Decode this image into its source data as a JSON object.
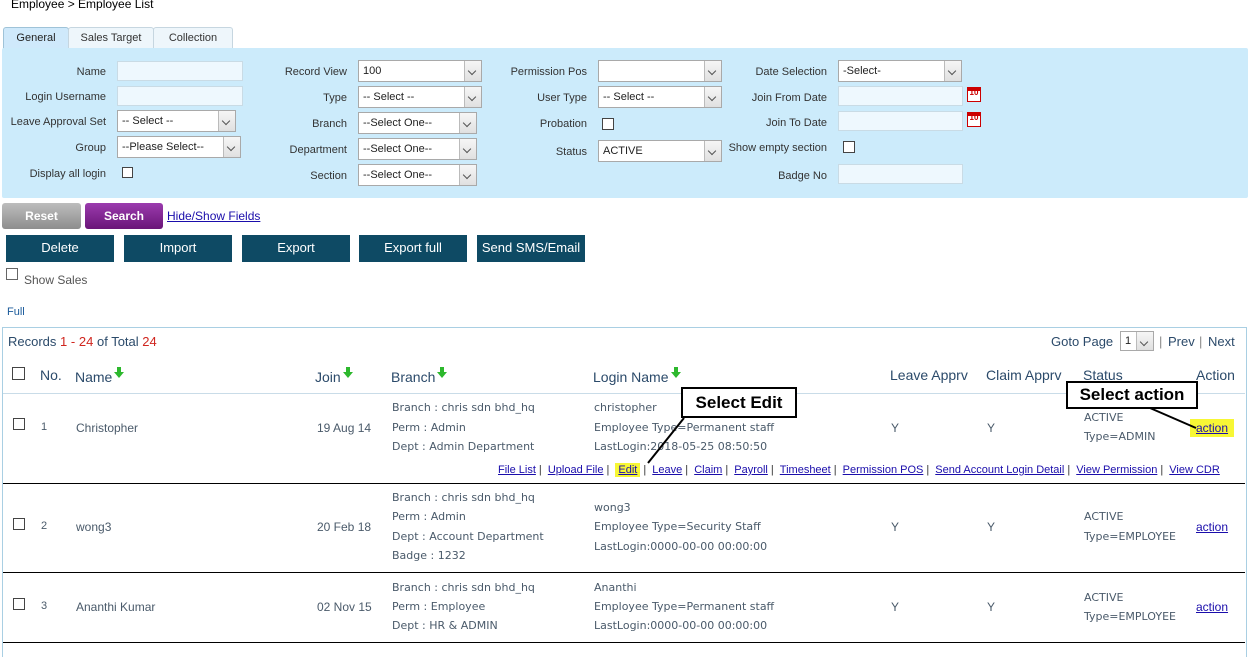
{
  "breadcrumb": "Employee > Employee List",
  "tabs": [
    "General",
    "Sales Target",
    "Collection"
  ],
  "filters": {
    "name_label": "Name",
    "login_username_label": "Login Username",
    "leave_approval_set_label": "Leave Approval Set",
    "leave_approval_set_value": "-- Select --",
    "group_label": "Group",
    "group_value": "--Please Select--",
    "display_all_login_label": "Display all login",
    "record_view_label": "Record View",
    "record_view_value": "100",
    "type_label": "Type",
    "type_value": "-- Select --",
    "branch_label": "Branch",
    "branch_value": "--Select One--",
    "department_label": "Department",
    "department_value": "--Select One--",
    "section_label": "Section",
    "section_value": "--Select One--",
    "permission_pos_label": "Permission Pos",
    "permission_pos_value": "",
    "user_type_label": "User Type",
    "user_type_value": "-- Select --",
    "probation_label": "Probation",
    "status_label": "Status",
    "status_value": "ACTIVE",
    "date_selection_label": "Date Selection",
    "date_selection_value": "-Select-",
    "join_from_date_label": "Join From Date",
    "join_to_date_label": "Join To Date",
    "show_empty_section_label": "Show empty section",
    "badge_no_label": "Badge No",
    "calendar_text": "10"
  },
  "buttons": {
    "reset": "Reset",
    "search": "Search",
    "hide_show": "Hide/Show Fields",
    "delete": "Delete",
    "import": "Import",
    "export": "Export",
    "export_full": "Export full",
    "send_sms": "Send SMS/Email"
  },
  "show_sales_label": "Show Sales",
  "full_link": "Full",
  "records": {
    "prefix": "Records",
    "start": "1",
    "dash": "-",
    "end": "24",
    "of_total": "of Total",
    "total": "24"
  },
  "pager": {
    "goto_label": "Goto Page",
    "page_value": "1",
    "prev": "Prev",
    "next": "Next",
    "sep": "|"
  },
  "columns": {
    "no": "No.",
    "name": "Name",
    "join": "Join",
    "branch": "Branch",
    "login_name": "Login Name",
    "leave_apprv": "Leave Apprv",
    "claim_apprv": "Claim Apprv",
    "status": "Status",
    "action": "Action"
  },
  "rows": [
    {
      "no": "1",
      "name": "Christopher",
      "join": "19 Aug 14",
      "branch": "Branch : chris sdn bhd_hq",
      "perm": "Perm : Admin",
      "dept": "Dept : Admin Department",
      "login": "christopher",
      "emp_type": "Employee Type=Permanent staff",
      "last_login": "LastLogin:2018-05-25 08:50:50",
      "leave": "Y",
      "claim": "Y",
      "status": "ACTIVE",
      "type": "Type=ADMIN",
      "action": "action"
    },
    {
      "no": "2",
      "name": "wong3",
      "join": "20 Feb 18",
      "branch": "Branch : chris sdn bhd_hq",
      "perm": "Perm : Admin",
      "dept": "Dept : Account Department",
      "badge": "Badge : 1232",
      "login": "wong3",
      "emp_type": "Employee Type=Security Staff",
      "last_login": "LastLogin:0000-00-00 00:00:00",
      "leave": "Y",
      "claim": "Y",
      "status": "ACTIVE",
      "type": "Type=EMPLOYEE",
      "action": "action"
    },
    {
      "no": "3",
      "name": "Ananthi Kumar",
      "join": "02 Nov 15",
      "branch": "Branch : chris sdn bhd_hq",
      "perm": "Perm : Employee",
      "dept": "Dept : HR & ADMIN",
      "login": "Ananthi",
      "emp_type": "Employee Type=Permanent staff",
      "last_login": "LastLogin:0000-00-00 00:00:00",
      "leave": "Y",
      "claim": "Y",
      "status": "ACTIVE",
      "type": "Type=EMPLOYEE",
      "action": "action"
    }
  ],
  "action_links": [
    "File List",
    "Upload File",
    "Edit",
    "Leave",
    "Claim",
    "Payroll",
    "Timesheet",
    "Permission POS",
    "Send Account Login Detail",
    "View Permission",
    "View CDR"
  ],
  "callouts": {
    "edit": "Select Edit",
    "action": "Select action"
  },
  "colors": {
    "filter_bg": "#ccebfb",
    "dark_button": "#0e4a64",
    "search_button": "#7b1f8a",
    "highlight": "#f7f735"
  }
}
